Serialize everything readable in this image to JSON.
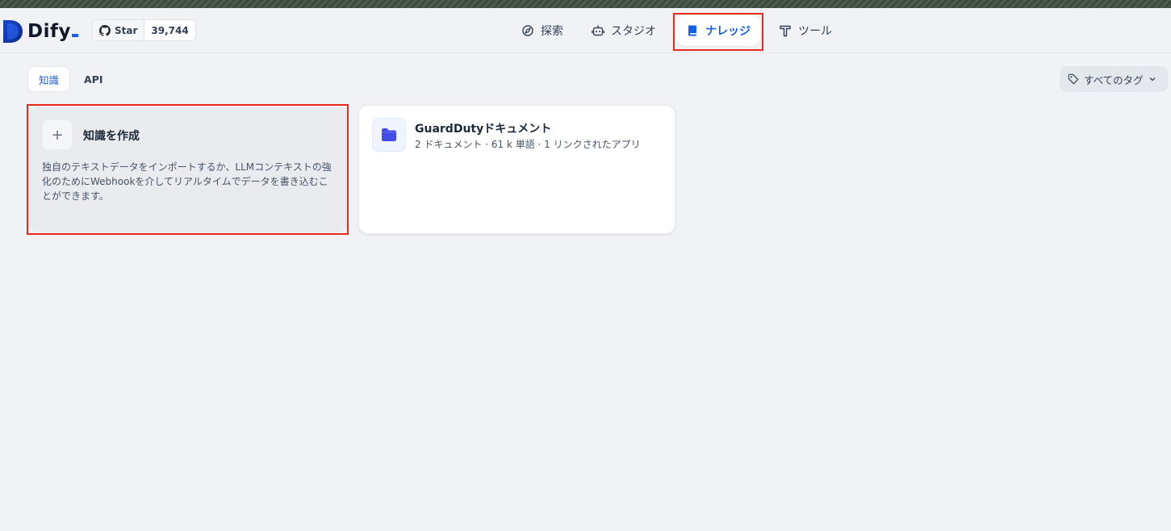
{
  "app": {
    "name": "Dify"
  },
  "github": {
    "star_label": "Star",
    "star_count": "39,744",
    "icon": "github-icon"
  },
  "nav": {
    "items": [
      {
        "label": "探索",
        "icon": "compass-icon"
      },
      {
        "label": "スタジオ",
        "icon": "robot-icon"
      },
      {
        "label": "ナレッジ",
        "icon": "book-icon",
        "active": true
      },
      {
        "label": "ツール",
        "icon": "hammer-icon"
      }
    ]
  },
  "tabs": [
    {
      "label": "知識",
      "active": true
    },
    {
      "label": "API",
      "active": false
    }
  ],
  "tag_filter": {
    "label": "すべてのタグ",
    "icon": "tag-icon"
  },
  "create_card": {
    "icon": "plus-icon",
    "title": "知識を作成",
    "description": "独自のテキストデータをインポートするか、LLMコンテキストの強化のためにWebhookを介してリアルタイムでデータを書き込むことができます。"
  },
  "datasets": [
    {
      "icon": "folder-icon",
      "title": "GuardDutyドキュメント",
      "meta": "2 ドキュメント · 61 k 単語 · 1 リンクされたアプリ"
    }
  ],
  "colors": {
    "accent": "#155eef",
    "highlight": "#e8291c",
    "background": "#f0f2f6"
  }
}
